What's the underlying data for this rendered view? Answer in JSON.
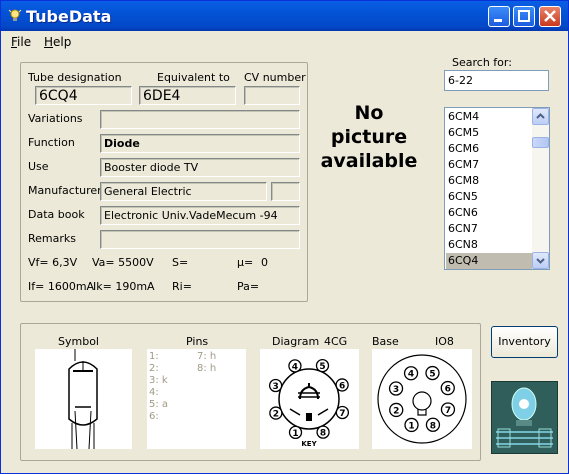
{
  "window": {
    "title": "TubeData"
  },
  "menu": {
    "file": "File",
    "file_key": "F",
    "file_rest": "ile",
    "help": "Help",
    "help_key": "H",
    "help_rest": "elp"
  },
  "labels": {
    "tube_designation": "Tube designation",
    "equivalent_to": "Equivalent to",
    "cv_number": "CV number",
    "variations": "Variations",
    "function": "Function",
    "use": "Use",
    "manufacturer": "Manufacturer",
    "data_book": "Data book",
    "remarks": "Remarks",
    "vf": "Vf= 6,3V",
    "va": "Va= 5500V",
    "s": "S=",
    "mu": "µ=",
    "mu_val": "0",
    "if": "If= 1600mA",
    "ik": "Ik= 190mA",
    "ri": "Ri=",
    "pa": "Pa="
  },
  "fields": {
    "tube_designation": "6CQ4",
    "equivalent_to": "6DE4",
    "cv_number": "",
    "variations": "",
    "function": "Diode",
    "use": "Booster diode TV",
    "manufacturer": "General Electric",
    "manufacturer_extra": "",
    "data_book": "Electronic Univ.VadeMecum -94",
    "remarks": ""
  },
  "picture": {
    "text1": "No",
    "text2": "picture",
    "text3": "available"
  },
  "search": {
    "label": "Search for:",
    "value": "6-22"
  },
  "list": {
    "items": [
      "6CM4",
      "6CM5",
      "6CM6",
      "6CM7",
      "6CM8",
      "6CN5",
      "6CN6",
      "6CN7",
      "6CN8",
      "6CQ4"
    ],
    "selected": "6CQ4"
  },
  "buttons": {
    "inventory": "Inventory"
  },
  "bottom": {
    "symbol": "Symbol",
    "pins": "Pins",
    "diagram": "Diagram",
    "diagram_code": "4CG",
    "base": "Base",
    "base_code": "IO8",
    "pins_list": [
      {
        "left": "1:",
        "right": "7: h"
      },
      {
        "left": "2:",
        "right": "8: h"
      },
      {
        "left": "3: k",
        "right": ""
      },
      {
        "left": "4:",
        "right": ""
      },
      {
        "left": "5: a",
        "right": ""
      },
      {
        "left": "6:",
        "right": ""
      }
    ],
    "diagram_pins": [
      "1",
      "2",
      "3",
      "4",
      "5",
      "6",
      "7",
      "8"
    ],
    "diagram_key": "KEY",
    "base_pins": [
      "1",
      "2",
      "3",
      "4",
      "5",
      "6",
      "7",
      "8"
    ]
  },
  "colors": {
    "titlebar": "#0453d6",
    "window_bg": "#ece9d8",
    "selection": "#c1bcb0",
    "pin_text": "#a09a86"
  }
}
